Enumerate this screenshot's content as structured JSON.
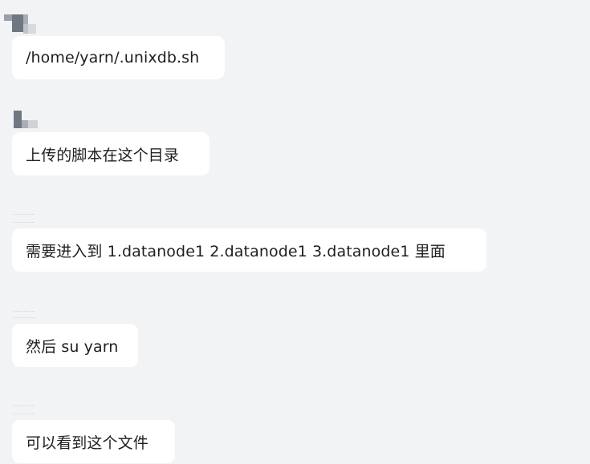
{
  "messages": [
    {
      "text": "/home/yarn/.unixdb.sh"
    },
    {
      "text": "上传的脚本在这个目录"
    },
    {
      "text": "需要进入到 1.datanode1  2.datanode1 3.datanode1 里面"
    },
    {
      "text": "然后 su yarn"
    },
    {
      "text": "可以看到这个文件"
    }
  ],
  "colors": {
    "background": "#f2f3f5",
    "bubble": "#ffffff",
    "text": "#1f1f1f"
  }
}
